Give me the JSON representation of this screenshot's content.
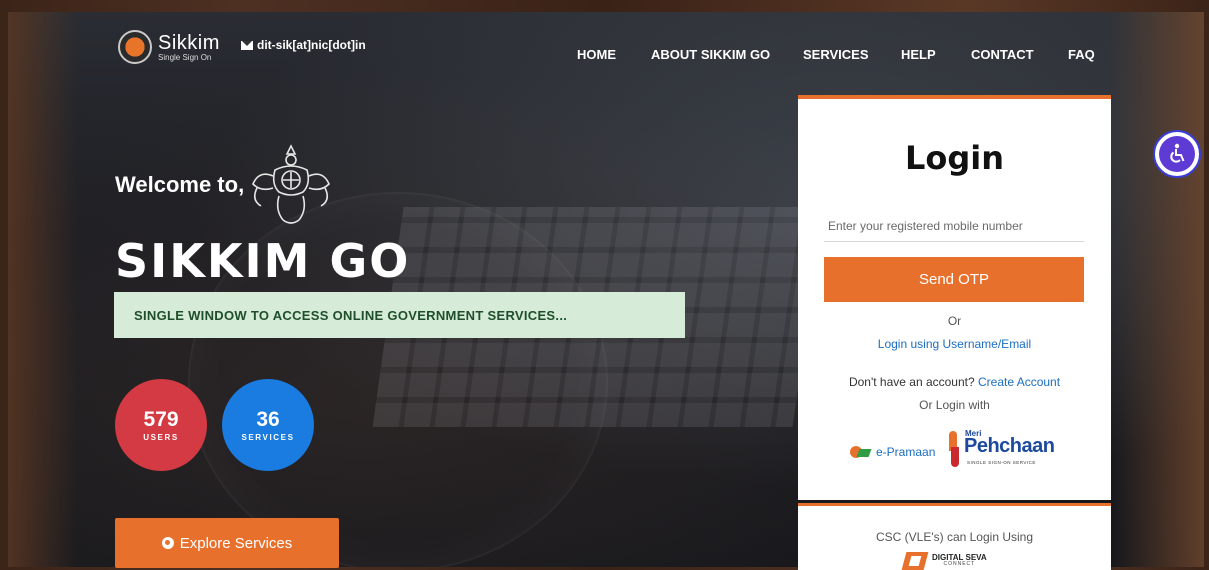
{
  "header": {
    "brand_title": "Sikkim",
    "brand_subtitle": "Single Sign On",
    "email": "dit-sik[at]nic[dot]in"
  },
  "nav": {
    "items": [
      {
        "label": "HOME"
      },
      {
        "label": "ABOUT SIKKIM GO"
      },
      {
        "label": "SERVICES"
      },
      {
        "label": "HELP"
      },
      {
        "label": "CONTACT"
      },
      {
        "label": "FAQ"
      }
    ]
  },
  "hero": {
    "welcome": "Welcome to,",
    "title": "SIKKIM GO",
    "banner": "SINGLE WINDOW TO ACCESS ONLINE GOVERNMENT SERVICES...",
    "stats": [
      {
        "value": "579",
        "label": "USERS",
        "color": "#d43a43"
      },
      {
        "value": "36",
        "label": "SERVICES",
        "color": "#1a7be0"
      }
    ],
    "explore_label": "Explore Services"
  },
  "login": {
    "title": "Login",
    "mobile_placeholder": "Enter your registered mobile number",
    "send_otp_label": "Send OTP",
    "or_text": "Or",
    "alt_login_label": "Login using Username/Email",
    "no_account_text": "Don't have an account?",
    "create_account_label": "Create Account",
    "or_login_with": "Or Login with",
    "epramaan_label": "e-Pramaan",
    "meri_pehchaan": {
      "meri": "Meri",
      "name": "Pehchaan",
      "tagline": "SINGLE SIGN-ON SERVICE"
    }
  },
  "csc": {
    "text": "CSC (VLE's) can Login Using",
    "logo_main": "DIGITAL SEVA",
    "logo_sub": "CONNECT"
  },
  "colors": {
    "accent": "#e8702d",
    "banner_bg": "#d6ecd8",
    "link": "#1b6ec2"
  },
  "icons": {
    "mail": "mail-icon",
    "globe": "globe-icon",
    "accessibility": "accessibility-icon"
  }
}
